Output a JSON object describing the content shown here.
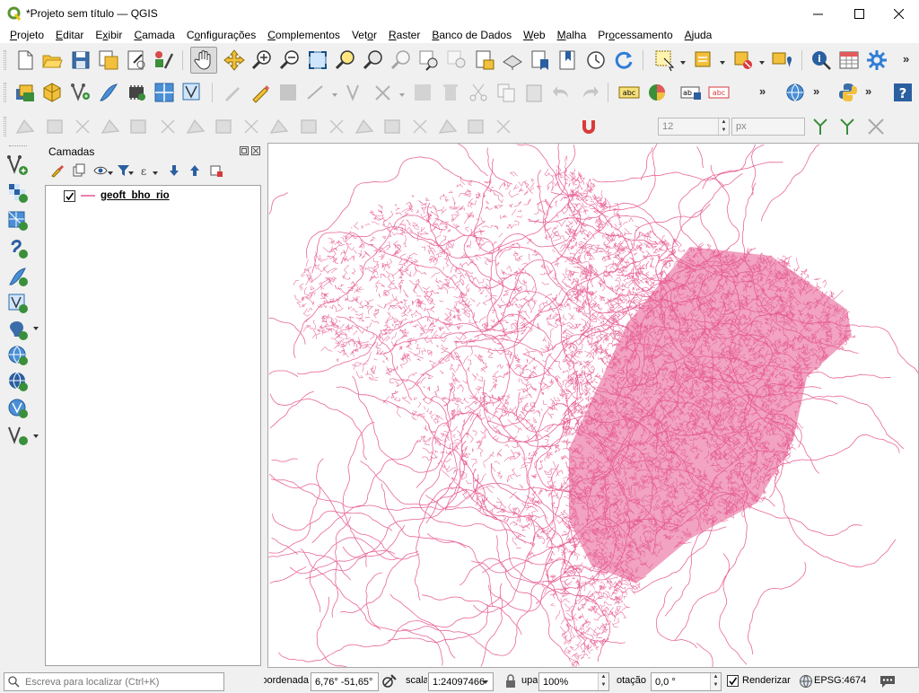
{
  "window": {
    "title": "*Projeto sem título — QGIS",
    "accent": "#589632"
  },
  "menu": [
    {
      "pre": "",
      "u": "P",
      "post": "rojeto"
    },
    {
      "pre": "",
      "u": "E",
      "post": "ditar"
    },
    {
      "pre": "E",
      "u": "x",
      "post": "ibir"
    },
    {
      "pre": "",
      "u": "C",
      "post": "amada"
    },
    {
      "pre": "C",
      "u": "o",
      "post": "nfigurações"
    },
    {
      "pre": "",
      "u": "C",
      "post": "omplementos"
    },
    {
      "pre": "Vet",
      "u": "o",
      "post": "r"
    },
    {
      "pre": "",
      "u": "R",
      "post": "aster"
    },
    {
      "pre": "",
      "u": "B",
      "post": "anco de Dados"
    },
    {
      "pre": "",
      "u": "W",
      "post": "eb"
    },
    {
      "pre": "",
      "u": "M",
      "post": "alha"
    },
    {
      "pre": "Pr",
      "u": "o",
      "post": "cessamento"
    },
    {
      "pre": "",
      "u": "A",
      "post": "juda"
    }
  ],
  "toolbar": {
    "snap_tolerance": "12",
    "snap_unit": "px"
  },
  "layers_panel": {
    "title": "Camadas",
    "layers": [
      {
        "name": "geoft_bho_rio",
        "visible": true,
        "color": "#e5578e"
      }
    ]
  },
  "status_bar": {
    "locator_placeholder": "Escreva para localizar (Ctrl+K)",
    "coord_label": "Coordenada",
    "coord_value": "6,76° -51,65°",
    "scale_label": "scala",
    "scale_value": "1:24097466",
    "magnifier_label": "upa",
    "magnifier_value": "100%",
    "rotation_label": "Rotação",
    "rotation_value": "0,0 °",
    "render_label": "Renderizar",
    "render_checked": true,
    "crs": "EPSG:4674"
  },
  "map": {
    "line_color": "#e5578e",
    "background": "#ffffff"
  }
}
